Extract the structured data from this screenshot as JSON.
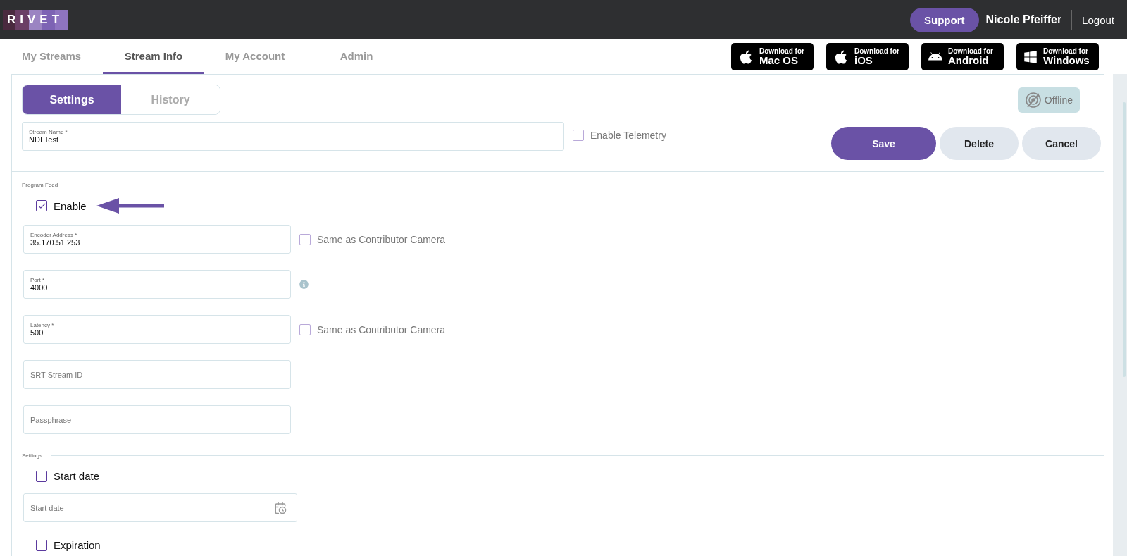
{
  "header": {
    "logo": "RIVET",
    "support": "Support",
    "user": "Nicole Pfeiffer",
    "logout": "Logout"
  },
  "nav_tabs": [
    {
      "label": "My Streams",
      "selected": false
    },
    {
      "label": "Stream Info",
      "selected": true
    },
    {
      "label": "My Account",
      "selected": false
    },
    {
      "label": "Admin",
      "selected": false
    }
  ],
  "downloads": [
    {
      "kind": "apple",
      "line1": "Download for",
      "line2": "Mac OS"
    },
    {
      "kind": "apple",
      "line1": "Download for",
      "line2": "iOS"
    },
    {
      "kind": "android",
      "line1": "Download for",
      "line2": "Android"
    },
    {
      "kind": "windows",
      "line1": "Download for",
      "line2": "Windows"
    }
  ],
  "sub_tabs": [
    {
      "label": "Settings",
      "selected": true
    },
    {
      "label": "History",
      "selected": false
    }
  ],
  "status_badge": {
    "label": "Offline"
  },
  "stream_name": {
    "label": "Stream Name *",
    "value": "NDI Test"
  },
  "telemetry": {
    "label": "Enable Telemetry",
    "checked": false
  },
  "actions": [
    {
      "label": "Save",
      "kind": "primary"
    },
    {
      "label": "Delete",
      "kind": "secondary"
    },
    {
      "label": "Cancel",
      "kind": "secondary"
    }
  ],
  "program_feed": {
    "legend": "Program Feed",
    "enable": {
      "label": "Enable",
      "checked": true
    },
    "fields": [
      {
        "label": "Encoder Address *",
        "value": "35.170.51.253",
        "side": {
          "kind": "checkbox",
          "label": "Same as Contributor Camera",
          "checked": false
        }
      },
      {
        "label": "Port *",
        "value": "4000",
        "side": {
          "kind": "info"
        }
      },
      {
        "label": "Latency *",
        "value": "500",
        "side": {
          "kind": "checkbox",
          "label": "Same as Contributor Camera",
          "checked": false
        }
      },
      {
        "placeholder": "SRT Stream ID"
      },
      {
        "placeholder": "Passphrase"
      }
    ]
  },
  "settings": {
    "legend": "Settings",
    "start": {
      "label": "Start date",
      "checked": false
    },
    "start_field": {
      "placeholder": "Start date"
    },
    "expiration": {
      "label": "Expiration",
      "checked": false
    }
  }
}
